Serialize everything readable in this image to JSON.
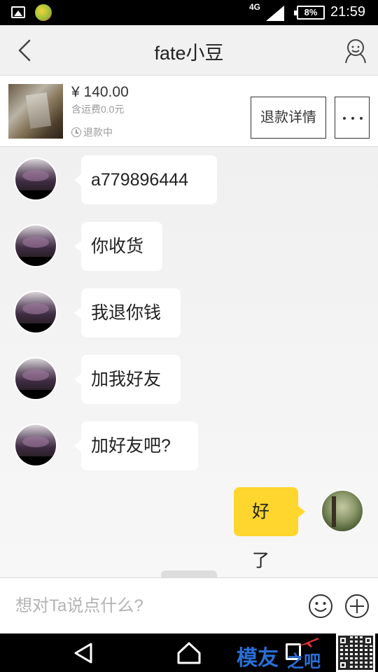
{
  "status_bar": {
    "network": "4G",
    "battery": "8%",
    "time": "21:59",
    "icons": [
      "gallery-icon",
      "app-notification-icon",
      "signal-icon",
      "battery-icon"
    ]
  },
  "header": {
    "title": "fate小豆",
    "back_icon": "chevron-left-icon",
    "profile_icon": "user-profile-icon"
  },
  "order": {
    "price": "¥ 140.00",
    "shipping": "含运费0.0元",
    "status": "退款中",
    "refund_button": "退款详情",
    "more_icon": "more-dots-icon"
  },
  "messages": [
    {
      "side": "left",
      "text": "a779896444"
    },
    {
      "side": "left",
      "text": "你收货"
    },
    {
      "side": "left",
      "text": "我退你钱"
    },
    {
      "side": "left",
      "text": "加我好友"
    },
    {
      "side": "left",
      "text": "加好友吧?"
    },
    {
      "side": "right",
      "text": "好了"
    }
  ],
  "input": {
    "placeholder": "想对Ta说点什么?",
    "value": "",
    "emoji_icon": "emoji-icon",
    "plus_icon": "plus-circle-icon"
  },
  "nav": {
    "icons": [
      "nav-back-icon",
      "nav-home-icon",
      "nav-recent-icon"
    ]
  },
  "watermark": {
    "text_main": "模友",
    "text_small": "之吧"
  },
  "colors": {
    "accent_bubble": "#fed62d",
    "background": "#f1f1f1",
    "text": "#222222"
  }
}
